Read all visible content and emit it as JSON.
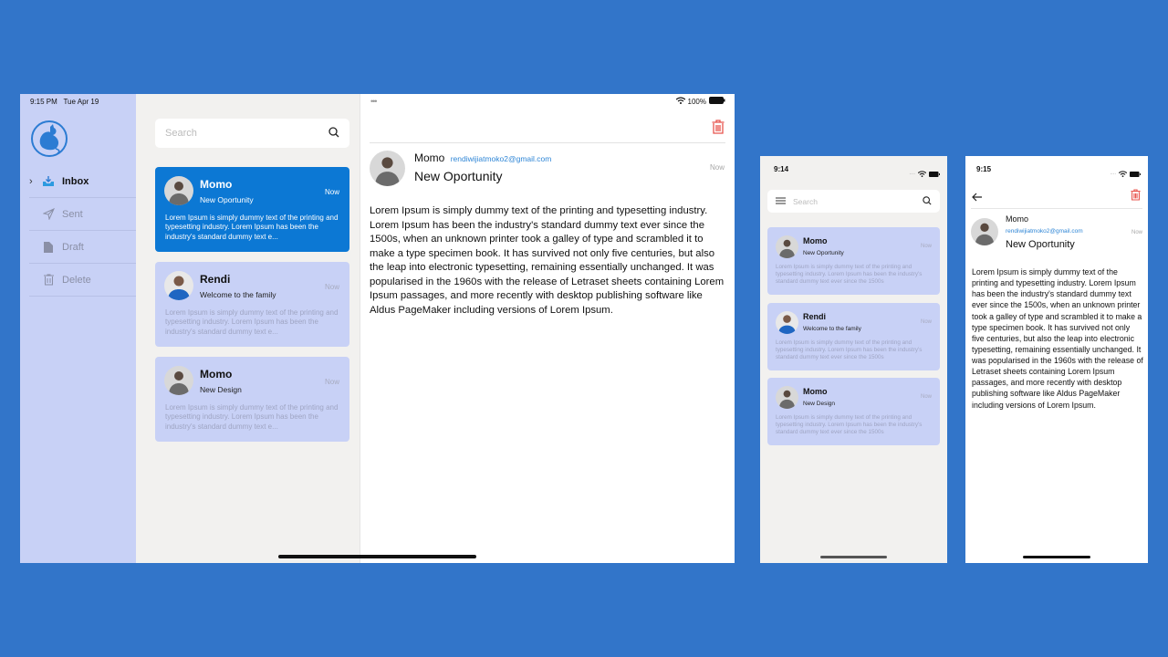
{
  "ipad": {
    "status": {
      "time": "9:15 PM",
      "date": "Tue Apr 19",
      "dots": "•••",
      "battery": "100%"
    },
    "sidebar": {
      "logo": "cat-logo",
      "items": [
        {
          "label": "Inbox",
          "icon": "inbox-icon",
          "active": true
        },
        {
          "label": "Sent",
          "icon": "paper-plane-icon",
          "active": false
        },
        {
          "label": "Draft",
          "icon": "document-icon",
          "active": false
        },
        {
          "label": "Delete",
          "icon": "trash-icon",
          "active": false
        }
      ]
    },
    "search": {
      "placeholder": "Search"
    },
    "messages": [
      {
        "name": "Momo",
        "subject": "New Oportunity",
        "time": "Now",
        "preview": "Lorem Ipsum is simply dummy text of the printing and typesetting industry. Lorem Ipsum has been the industry's standard dummy text e...",
        "selected": true
      },
      {
        "name": "Rendi",
        "subject": "Welcome to the family",
        "time": "Now",
        "preview": "Lorem Ipsum is simply dummy text of the printing and typesetting industry. Lorem Ipsum has been the industry's standard dummy text e...",
        "selected": false
      },
      {
        "name": "Momo",
        "subject": "New Design",
        "time": "Now",
        "preview": "Lorem Ipsum is simply dummy text of the printing and typesetting industry. Lorem Ipsum has been the industry's standard dummy text e...",
        "selected": false
      }
    ],
    "detail": {
      "sender": "Momo",
      "email": "rendiwijiatmoko2@gmail.com",
      "subject": "New Oportunity",
      "time": "Now",
      "body": "Lorem Ipsum is simply dummy text of the printing and typesetting industry. Lorem Ipsum has been the industry's standard dummy text ever since the 1500s, when an unknown printer took a galley of type and scrambled it to make a type specimen book. It has survived not only five centuries, but also the leap into electronic typesetting, remaining essentially unchanged. It was popularised in the 1960s with the release of Letraset sheets containing Lorem Ipsum passages, and more recently with desktop publishing software like Aldus PageMaker including versions of Lorem Ipsum."
    }
  },
  "phone_list": {
    "status": {
      "time": "9:14"
    },
    "search": {
      "placeholder": "Search"
    },
    "messages": [
      {
        "name": "Momo",
        "subject": "New Oportunity",
        "time": "Now",
        "preview": "Lorem Ipsum is simply dummy text of the printing and typesetting industry. Lorem Ipsum has been the industry's standard dummy text ever since the 1500s"
      },
      {
        "name": "Rendi",
        "subject": "Welcome to the family",
        "time": "Now",
        "preview": "Lorem Ipsum is simply dummy text of the printing and typesetting industry. Lorem Ipsum has been the industry's standard dummy text ever since the 1500s"
      },
      {
        "name": "Momo",
        "subject": "New Design",
        "time": "Now",
        "preview": "Lorem Ipsum is simply dummy text of the printing and typesetting industry. Lorem Ipsum has been the industry's standard dummy text ever since the 1500s"
      }
    ]
  },
  "phone_detail": {
    "status": {
      "time": "9:15"
    },
    "sender": "Momo",
    "email": "rendiwijiatmoko2@gmail.com",
    "subject": "New Oportunity",
    "time": "Now",
    "body": "Lorem Ipsum is simply dummy text of the printing and typesetting industry. Lorem Ipsum has been the industry's standard dummy text ever since the 1500s, when an unknown printer took a galley of type and scrambled it to make a type specimen book. It has survived not only five centuries, but also the leap into electronic typesetting, remaining essentially unchanged. It was popularised in the 1960s with the release of Letraset sheets containing Lorem Ipsum passages, and more recently with desktop publishing software like Aldus PageMaker including versions of Lorem Ipsum."
  },
  "colors": {
    "background": "#3275c9",
    "accent": "#0c78d4",
    "card": "#c8d1f6",
    "delete": "#e8554e",
    "link": "#2f86d6"
  }
}
